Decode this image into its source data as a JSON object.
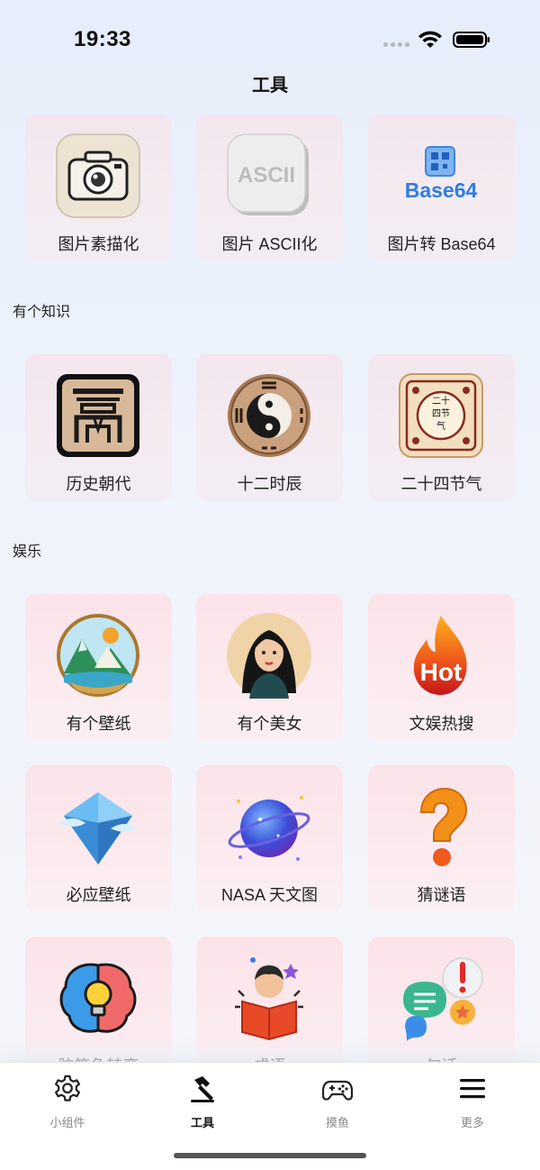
{
  "status_bar": {
    "time": "19:33"
  },
  "header": {
    "title": "工具"
  },
  "sections": {
    "tools": {
      "items": [
        {
          "label": "图片素描化",
          "icon": "camera-sketch-icon"
        },
        {
          "label": "图片 ASCII化",
          "icon": "ascii-icon"
        },
        {
          "label": "图片转 Base64",
          "icon": "base64-icon"
        }
      ]
    },
    "knowledge": {
      "title": "有个知识",
      "items": [
        {
          "label": "历史朝代",
          "icon": "dynasty-icon"
        },
        {
          "label": "十二时辰",
          "icon": "yin-yang-icon"
        },
        {
          "label": "二十四节气",
          "icon": "solar-terms-icon"
        }
      ]
    },
    "entertainment": {
      "title": "娱乐",
      "items": [
        {
          "label": "有个壁纸",
          "icon": "landscape-icon"
        },
        {
          "label": "有个美女",
          "icon": "portrait-icon"
        },
        {
          "label": "文娱热搜",
          "icon": "hot-flame-icon",
          "badge": "Hot"
        },
        {
          "label": "必应壁纸",
          "icon": "bing-diamond-icon"
        },
        {
          "label": "NASA 天文图",
          "icon": "planet-icon"
        },
        {
          "label": "猜谜语",
          "icon": "question-mark-icon"
        },
        {
          "label": "脑筋急转弯",
          "icon": "brain-bulb-icon"
        },
        {
          "label": "成语",
          "icon": "reading-boy-icon"
        },
        {
          "label": "句话",
          "icon": "chat-bubbles-icon"
        }
      ]
    }
  },
  "base64_logo_text": "Base64",
  "ascii_logo_text": "ASCII",
  "solar_terms_text": "二十四节气",
  "tabbar": {
    "items": [
      {
        "label": "小组件",
        "icon": "gear-icon",
        "active": false
      },
      {
        "label": "工具",
        "icon": "hammer-icon",
        "active": true
      },
      {
        "label": "摸鱼",
        "icon": "gamepad-icon",
        "active": false
      },
      {
        "label": "更多",
        "icon": "menu-icon",
        "active": false
      }
    ]
  },
  "colors": {
    "accent": "#111111",
    "inactive": "#8a8a8e",
    "card_bg": "#f3e6ee"
  }
}
